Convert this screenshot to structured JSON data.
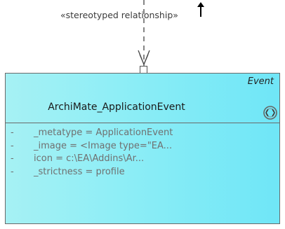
{
  "relationship": {
    "label": "«stereotyped relationship»"
  },
  "element": {
    "stereotype": "Event",
    "name": "ArchiMate_ApplicationEvent",
    "icon": "archimate-event-icon",
    "attributes": [
      {
        "visibility": "-",
        "text": "_metatype = ApplicationEvent"
      },
      {
        "visibility": "-",
        "text": "_image = <Image type=\"EA..."
      },
      {
        "visibility": "-",
        "text": "icon = c:\\EA\\Addins\\Ar..."
      },
      {
        "visibility": "-",
        "text": "_strictness = profile"
      }
    ]
  },
  "colors": {
    "fill_start": "#a6f1f4",
    "fill_end": "#6fe6f7",
    "border": "#6a6a6a"
  }
}
